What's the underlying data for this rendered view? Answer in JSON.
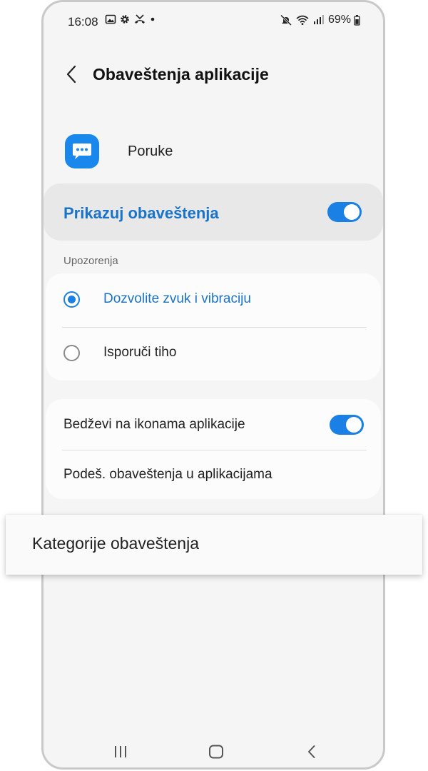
{
  "status_bar": {
    "time": "16:08",
    "battery": "69%",
    "icons": [
      "gallery-icon",
      "settings-gear-icon",
      "missed-call-icon",
      "dot-icon",
      "mute-icon",
      "wifi-icon",
      "signal-icon",
      "battery-icon"
    ]
  },
  "header": {
    "title": "Obaveštenja aplikacije",
    "back_icon": "chevron-left-icon"
  },
  "app": {
    "name": "Poruke",
    "icon": "messages-icon",
    "icon_color": "#1a87ec"
  },
  "show_notifications": {
    "label": "Prikazuj obaveštenja",
    "enabled": true
  },
  "alerts": {
    "section_label": "Upozorenja",
    "options": [
      {
        "label": "Dozvolite zvuk i vibraciju",
        "selected": true
      },
      {
        "label": "Isporuči tiho",
        "selected": false
      }
    ]
  },
  "more": {
    "badges_label": "Bedževi na ikonama aplikacije",
    "badges_enabled": true,
    "in_app_label": "Podeš. obaveštenja u aplikacijama"
  },
  "popup": {
    "label": "Kategorije obaveštenja"
  },
  "nav_bar": {
    "icons": [
      "recents-icon",
      "home-icon",
      "back-icon"
    ]
  },
  "colors": {
    "accent": "#1a80e5",
    "accent_text": "#1a73c9",
    "background": "#f5f5f5"
  }
}
